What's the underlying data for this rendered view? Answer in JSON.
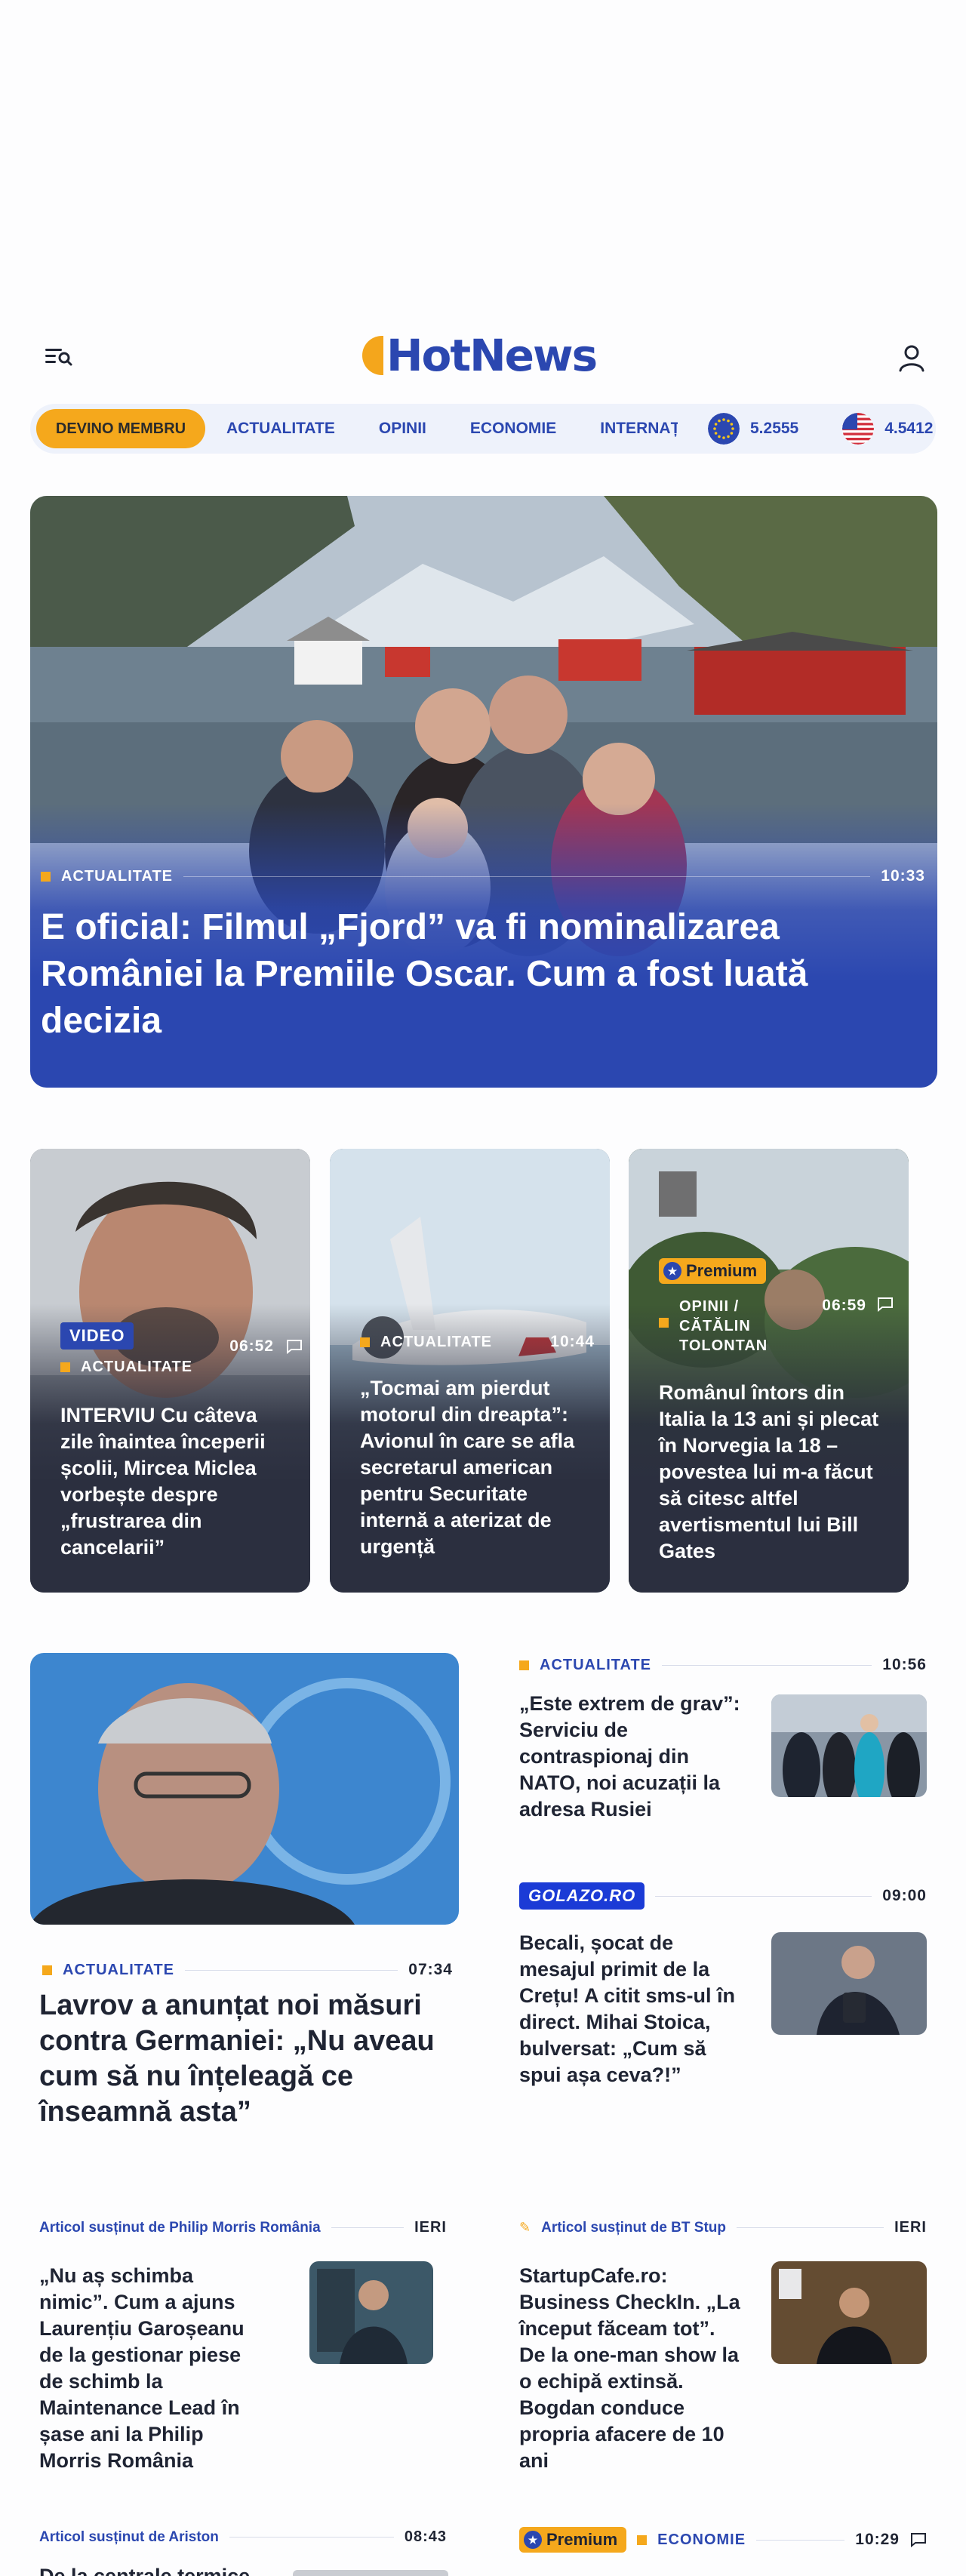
{
  "header": {
    "logo_text": "HotNews"
  },
  "nav": {
    "member_label": "DEVINO MEMBRU",
    "items": [
      "ACTUALITATE",
      "OPINII",
      "ECONOMIE",
      "INTERNAȚIONAL"
    ],
    "rates": [
      {
        "flag": "eu-flag-icon",
        "value": "5.2555"
      },
      {
        "flag": "us-flag-icon",
        "value": "4.5412"
      }
    ]
  },
  "hero": {
    "category": "ACTUALITATE",
    "time": "10:33",
    "title": "E oficial: Filmul „Fjord” va fi nominalizarea României la Premiile Oscar. Cum a fost luată decizia"
  },
  "cards": [
    {
      "badge": "VIDEO",
      "category": "ACTUALITATE",
      "time": "06:52",
      "title": "INTERVIU Cu câteva zile înaintea începerii școlii, Mircea Miclea vorbește despre „frustrarea din cancelarii”"
    },
    {
      "category": "ACTUALITATE",
      "time": "10:44",
      "title": "„Tocmai am pierdut motorul din dreapta”: Avionul în care se afla secretarul american pentru Securitate internă a aterizat de urgență"
    },
    {
      "badge": "Premium",
      "category": "OPINII / CĂTĂLIN TOLONTAN",
      "time": "06:59",
      "title": "Românul întors din Italia la 13 ani și plecat în Norvegia la 18 – povestea lui m-a făcut să citesc altfel avertismentul lui Bill Gates"
    }
  ],
  "main_story": {
    "category": "ACTUALITATE",
    "time": "07:34",
    "title": "Lavrov a anunțat noi măsuri contra Germaniei: „Nu aveau cum să nu înțeleagă ce înseamnă asta”"
  },
  "side_stories": [
    {
      "category": "ACTUALITATE",
      "time": "10:56",
      "title": "„Este extrem de grav”: Serviciu de contraspionaj din NATO, noi acuzații la adresa Rusiei"
    },
    {
      "badge": "GOLAZO.RO",
      "time": "09:00",
      "title": "Becali, șocat de mesajul primit de la Crețu! A citit sms-ul în direct. Mihai Stoica, bulversat: „Cum să spui așa ceva?!”"
    }
  ],
  "sponsored": [
    {
      "sponsor": "Articol susținut de Philip Morris România",
      "time": "IERI",
      "title": "„Nu aș schimba nimic”. Cum a ajuns Laurențiu Garoșeanu de la gestionar piese de schimb la Maintenance Lead în șase ani la Philip Morris România"
    },
    {
      "sponsor": "Articol susținut de BT Stup",
      "time": "IERI",
      "title": "StartupCafe.ro: Business CheckIn. „La început făceam tot”. De la one-man show la o echipă extinsă. Bogdan conduce propria afacere de 10 ani"
    }
  ],
  "bottom": [
    {
      "sponsor": "Articol susținut de Ariston",
      "time": "08:43",
      "title": "De la centrale termice"
    },
    {
      "badge": "Premium",
      "category": "ECONOMIE",
      "time": "10:29"
    }
  ]
}
